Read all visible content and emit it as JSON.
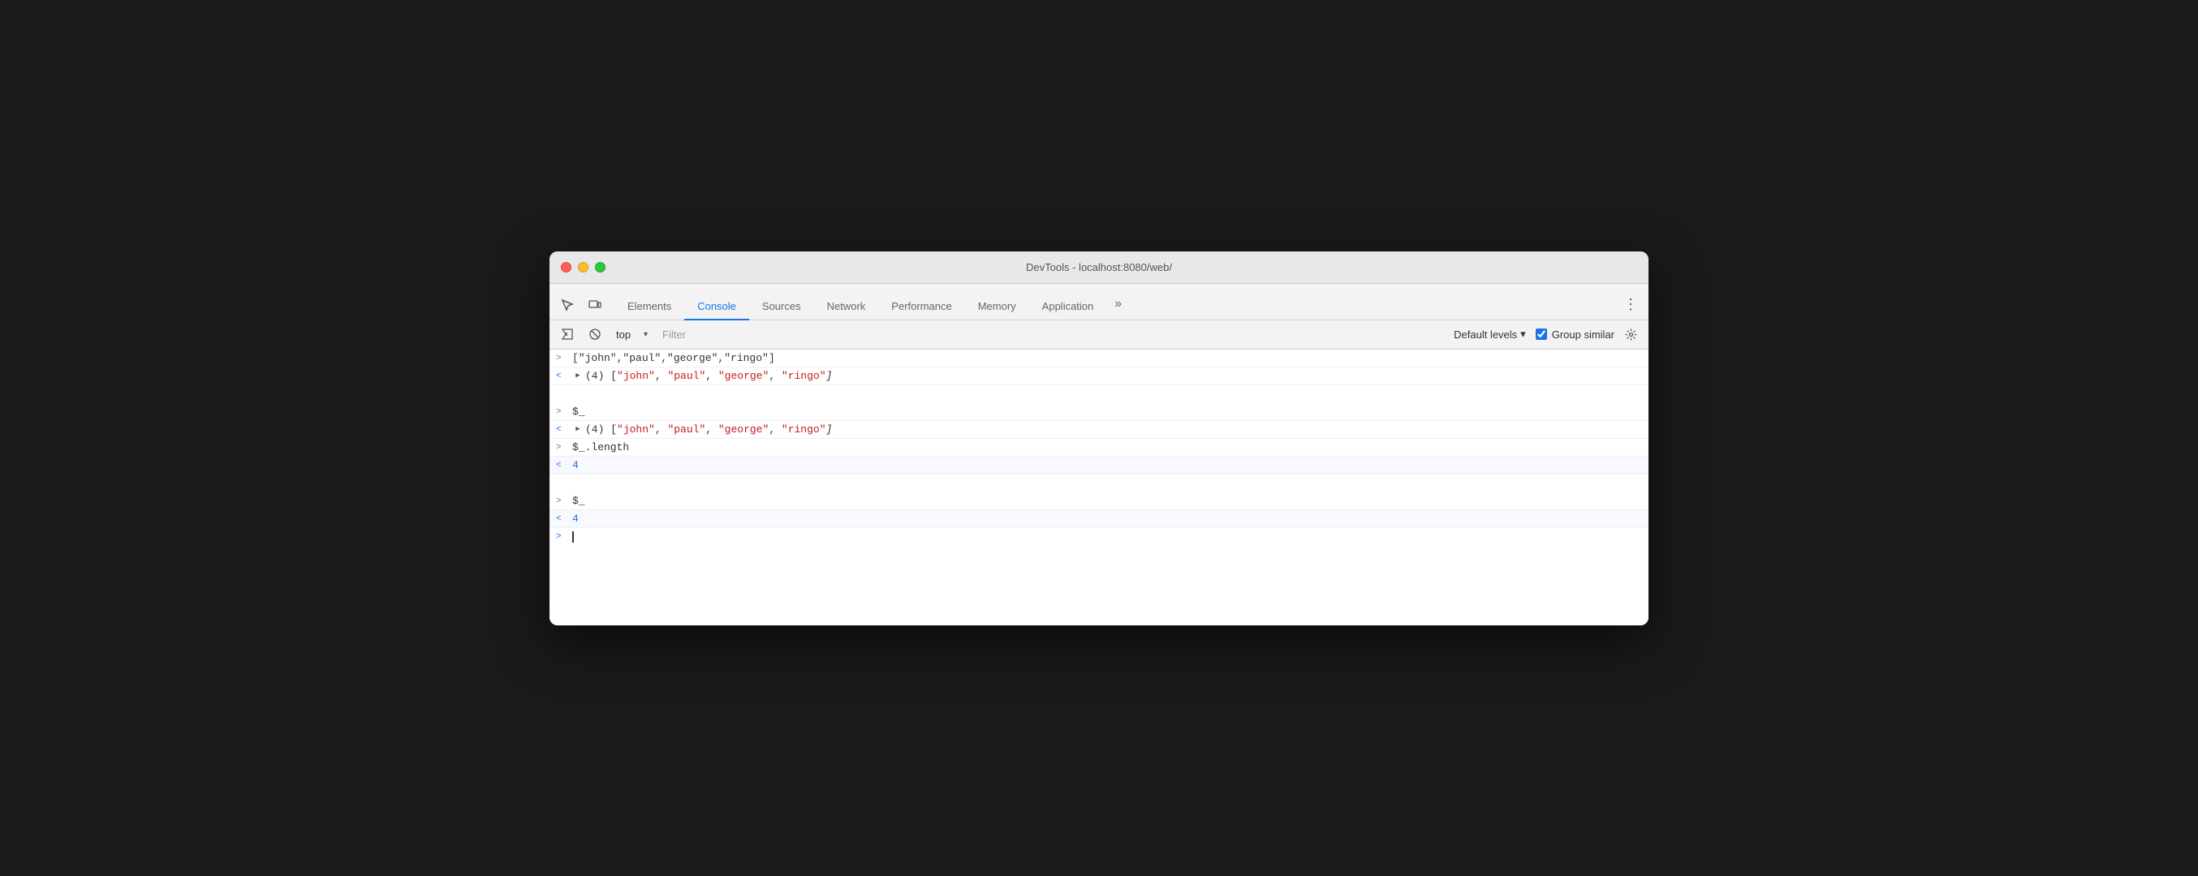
{
  "window": {
    "title": "DevTools - localhost:8080/web/"
  },
  "traffic_lights": {
    "close": "close",
    "minimize": "minimize",
    "maximize": "maximize"
  },
  "tabs": [
    {
      "id": "elements",
      "label": "Elements",
      "active": false
    },
    {
      "id": "console",
      "label": "Console",
      "active": true
    },
    {
      "id": "sources",
      "label": "Sources",
      "active": false
    },
    {
      "id": "network",
      "label": "Network",
      "active": false
    },
    {
      "id": "performance",
      "label": "Performance",
      "active": false
    },
    {
      "id": "memory",
      "label": "Memory",
      "active": false
    },
    {
      "id": "application",
      "label": "Application",
      "active": false
    }
  ],
  "toolbar": {
    "context_value": "top",
    "context_placeholder": "top",
    "filter_placeholder": "Filter",
    "default_levels_label": "Default levels",
    "group_similar_label": "Group similar"
  },
  "console_rows": [
    {
      "type": "input",
      "arrow": ">",
      "content": "[\"john\",\"paul\",\"george\",\"ringo\"]"
    },
    {
      "type": "output",
      "arrow": "<",
      "expandable": true,
      "prefix": "(4) ",
      "content": "[\"john\", \"paul\", \"george\", \"ringo\"]"
    },
    {
      "type": "spacer"
    },
    {
      "type": "input",
      "arrow": ">",
      "content": "$_"
    },
    {
      "type": "output",
      "arrow": "<",
      "expandable": true,
      "prefix": "(4) ",
      "content": "[\"john\", \"paul\", \"george\", \"ringo\"]"
    },
    {
      "type": "input",
      "arrow": ">",
      "content": "$_.length"
    },
    {
      "type": "result",
      "arrow": "<",
      "content": "4",
      "color": "blue"
    },
    {
      "type": "spacer"
    },
    {
      "type": "input",
      "arrow": ">",
      "content": "$_"
    },
    {
      "type": "result",
      "arrow": "<",
      "content": "4",
      "color": "blue"
    },
    {
      "type": "prompt",
      "arrow": ">"
    }
  ]
}
